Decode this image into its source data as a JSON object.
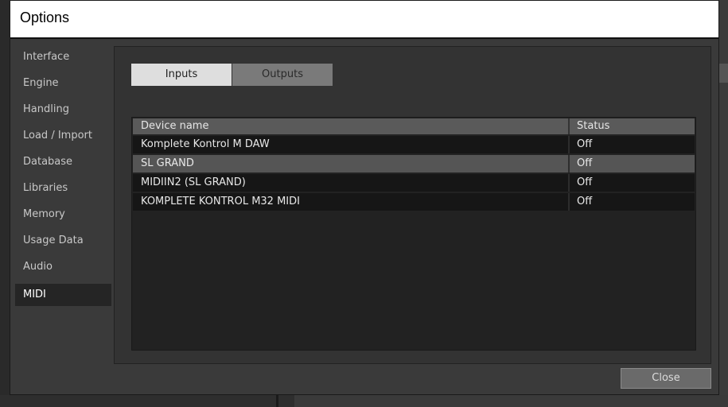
{
  "dialog": {
    "title": "Options",
    "close_label": "Close"
  },
  "sidebar": {
    "items": [
      {
        "label": "Interface"
      },
      {
        "label": "Engine"
      },
      {
        "label": "Handling"
      },
      {
        "label": "Load / Import"
      },
      {
        "label": "Database"
      },
      {
        "label": "Libraries"
      },
      {
        "label": "Memory"
      },
      {
        "label": "Usage Data"
      },
      {
        "label": "Audio"
      },
      {
        "label": "MIDI",
        "active": true
      }
    ]
  },
  "tabs": {
    "inputs": "Inputs",
    "outputs": "Outputs",
    "selected": "Inputs"
  },
  "devices": {
    "columns": [
      "Device name",
      "Status"
    ],
    "rows": [
      {
        "name": "Komplete Kontrol M DAW",
        "status": "Off"
      },
      {
        "name": "SL GRAND",
        "status": "Off",
        "selected": true
      },
      {
        "name": "MIDIIN2 (SL GRAND)",
        "status": "Off"
      },
      {
        "name": "KOMPLETE KONTROL M32 MIDI",
        "status": "Off"
      }
    ]
  },
  "colors": {
    "title_bg": "#ffffff",
    "panel_bg": "#333333",
    "selected_row": "#555555",
    "active_tab": "#dedede"
  }
}
